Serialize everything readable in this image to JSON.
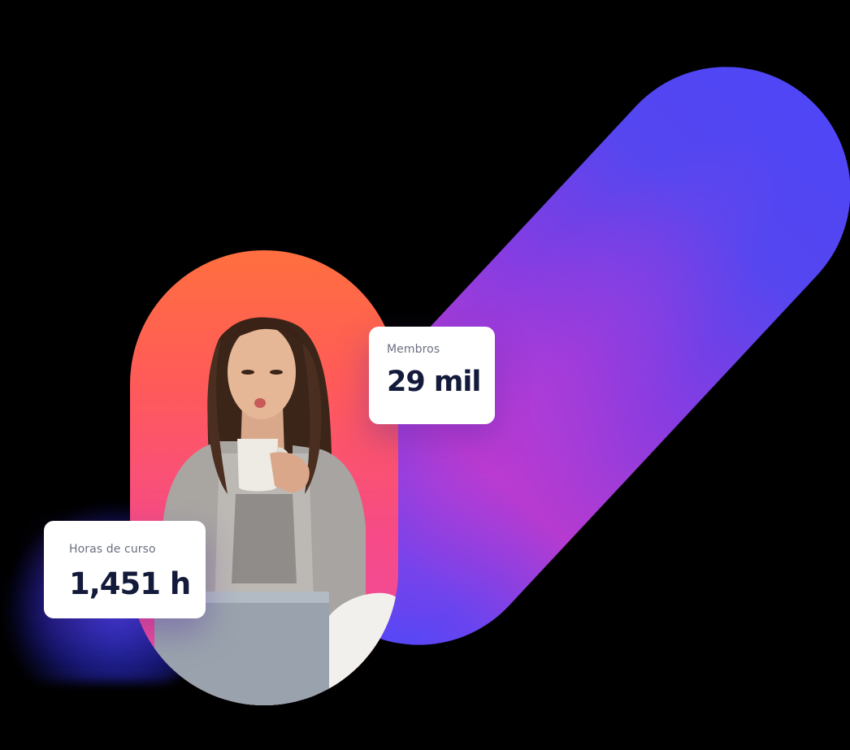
{
  "stats": {
    "members": {
      "label": "Membros",
      "value": "29 mil"
    },
    "hours": {
      "label": "Horas de curso",
      "value": "1,451 h"
    }
  },
  "colors": {
    "capsule_top": "#4f46f6",
    "capsule_mid": "#b63bd0",
    "pill_top": "#ff6f3f",
    "pill_bottom": "#ee4aa8",
    "card_bg": "#ffffff",
    "value_text": "#131a3a",
    "label_text": "#6b7080"
  },
  "imagery": {
    "photo_subject": "woman-drinking-coffee-with-laptop"
  }
}
